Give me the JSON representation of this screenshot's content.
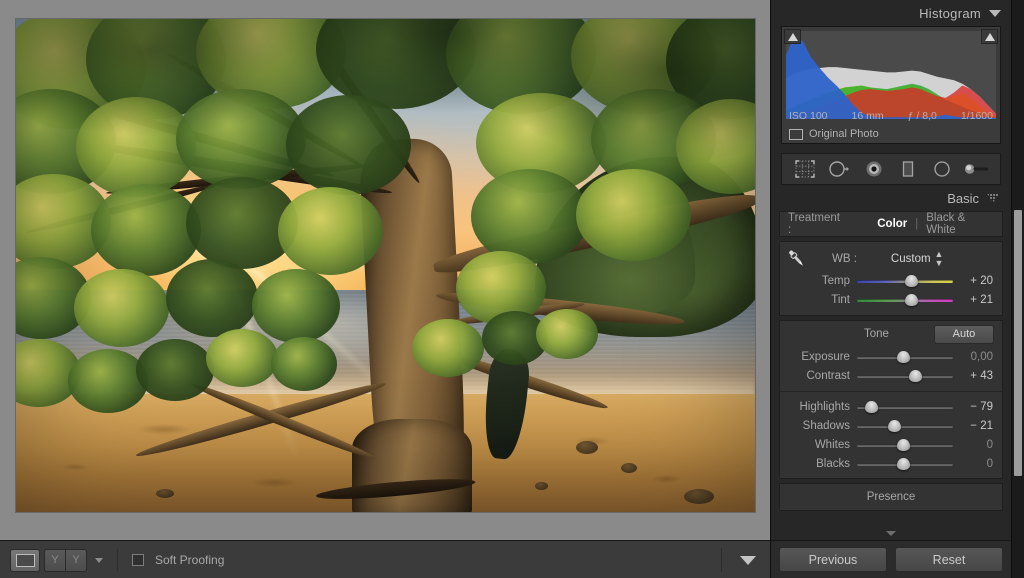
{
  "app": "Adobe Photoshop Lightroom - Develop",
  "histogram_panel": {
    "title": "Histogram",
    "collapse_icon": "chevron-down-icon",
    "clip_left_icon": "shadow-clipping-triangle-icon",
    "clip_right_icon": "highlight-clipping-triangle-icon",
    "metadata": {
      "iso": "ISO 100",
      "focal_length": "16 mm",
      "aperture": "ƒ / 8,0",
      "shutter": "1/1600"
    },
    "original_photo_label": "Original Photo",
    "original_photo_icon": "rectangle-icon"
  },
  "chart_data": {
    "type": "area",
    "title": "Histogram",
    "xlabel": "",
    "ylabel": "",
    "x": [
      0,
      4,
      8,
      12,
      16,
      20,
      24,
      28,
      32,
      36,
      40,
      44,
      48,
      52,
      56,
      60,
      64,
      68,
      72,
      76,
      80,
      84,
      88,
      92,
      96,
      100
    ],
    "series": [
      {
        "name": "Blue",
        "color": "#2d63c8",
        "values": [
          72,
          96,
          88,
          70,
          58,
          47,
          38,
          28,
          16,
          7,
          3,
          2,
          2,
          2,
          2,
          2,
          2,
          2,
          3,
          5,
          3,
          2,
          2,
          2,
          2,
          1
        ]
      },
      {
        "name": "Green",
        "color": "#2fa832",
        "values": [
          10,
          14,
          18,
          22,
          26,
          30,
          33,
          36,
          37,
          38,
          36,
          35,
          34,
          36,
          38,
          40,
          38,
          34,
          28,
          22,
          18,
          14,
          10,
          7,
          4,
          2
        ]
      },
      {
        "name": "Red",
        "color": "#d82c2c",
        "values": [
          4,
          6,
          8,
          11,
          14,
          18,
          22,
          26,
          30,
          33,
          34,
          33,
          32,
          33,
          34,
          36,
          34,
          30,
          26,
          24,
          30,
          38,
          34,
          26,
          16,
          6
        ]
      },
      {
        "name": "Yellow (R+G)",
        "color": "#e8e022",
        "values": [
          6,
          9,
          14,
          20,
          26,
          31,
          34,
          36,
          37,
          38,
          36,
          34,
          33,
          35,
          37,
          39,
          36,
          32,
          27,
          23,
          26,
          30,
          24,
          16,
          9,
          3
        ]
      },
      {
        "name": "Luminance (gray)",
        "color": "#d2d2d2",
        "values": [
          46,
          52,
          55,
          57,
          58,
          59,
          59,
          58,
          57,
          56,
          55,
          54,
          53,
          53,
          54,
          55,
          54,
          51,
          48,
          46,
          44,
          40,
          34,
          26,
          16,
          6
        ]
      }
    ],
    "xlim": [
      0,
      100
    ],
    "ylim": [
      0,
      100
    ],
    "grid": false,
    "legend": "none"
  },
  "tool_strip": {
    "tools": [
      {
        "name": "crop-overlay-tool",
        "icon": "crop-grid-icon",
        "active": false
      },
      {
        "name": "spot-removal-tool",
        "icon": "circle-arrow-icon",
        "active": false
      },
      {
        "name": "red-eye-correction-tool",
        "icon": "filled-circle-icon",
        "active": false
      },
      {
        "name": "graduated-filter-tool",
        "icon": "rectangle-gradient-icon",
        "active": false
      },
      {
        "name": "radial-filter-tool",
        "icon": "ellipse-icon",
        "active": false
      },
      {
        "name": "adjustment-brush-tool",
        "icon": "brush-slider-icon",
        "active": false
      }
    ]
  },
  "basic_panel": {
    "title": "Basic",
    "collapse_icon": "dotted-triangle-icon",
    "treatment": {
      "label": "Treatment :",
      "color_label": "Color",
      "separator": "|",
      "bw_label": "Black & White",
      "selected": "Color"
    },
    "white_balance": {
      "eyedropper_icon": "eyedropper-icon",
      "label": "WB :",
      "value": "Custom",
      "spinner_icon": "up-down-arrows-icon"
    },
    "wb_sliders": [
      {
        "name": "Temp",
        "value": "+ 20",
        "pos": 58,
        "track": "temp"
      },
      {
        "name": "Tint",
        "value": "+ 21",
        "pos": 58,
        "track": "tint"
      }
    ],
    "tone": {
      "label": "Tone",
      "auto_label": "Auto"
    },
    "tone_sliders": [
      {
        "name": "Exposure",
        "value": "0,00",
        "pos": 50,
        "zero": true
      },
      {
        "name": "Contrast",
        "value": "+ 43",
        "pos": 63,
        "zero": false
      }
    ],
    "tone_sliders2": [
      {
        "name": "Highlights",
        "value": "− 79",
        "pos": 16,
        "zero": false
      },
      {
        "name": "Shadows",
        "value": "− 21",
        "pos": 40,
        "zero": false
      },
      {
        "name": "Whites",
        "value": "0",
        "pos": 50,
        "zero": true
      },
      {
        "name": "Blacks",
        "value": "0",
        "pos": 50,
        "zero": true
      }
    ],
    "presence": {
      "label": "Presence"
    }
  },
  "panel_buttons": {
    "previous": "Previous",
    "reset": "Reset"
  },
  "toolbar": {
    "loupe_view_icon": "loupe-view-icon",
    "compare_before_icon": "before-view-icon",
    "compare_after_icon": "after-view-icon",
    "view_dropdown_icon": "caret-down-icon",
    "soft_proofing_label": "Soft Proofing",
    "soft_proofing_checked": false,
    "toolbar_toggle_icon": "caret-down-large-icon"
  },
  "colors": {
    "panel_bg": "#272727",
    "content_bg": "#8a8a8a",
    "accent_text": "#ffffff",
    "label_text": "#a8a8a8",
    "value_text": "#c9c9c9",
    "hist_blue": "#2d63c8",
    "hist_yellow": "#e8e022",
    "hist_red": "#d82c2c",
    "hist_green": "#2fa832"
  },
  "photo": {
    "description": "Tropical beach at sunset seen through a frangipani tree canopy"
  }
}
